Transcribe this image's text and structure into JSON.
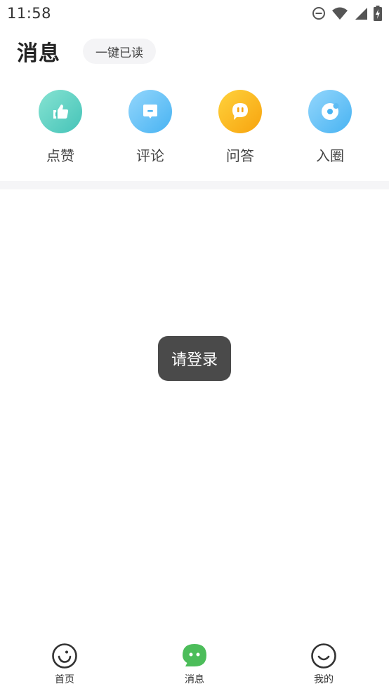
{
  "status_bar": {
    "time": "11:58"
  },
  "header": {
    "title": "消息",
    "mark_all_read": "一键已读"
  },
  "categories": [
    {
      "label": "点赞",
      "icon": "thumbs-up-icon",
      "colors": [
        "#7fe0cf",
        "#49c6bb"
      ]
    },
    {
      "label": "评论",
      "icon": "comment-icon",
      "colors": [
        "#8fd3fb",
        "#4bb6f3"
      ]
    },
    {
      "label": "问答",
      "icon": "qa-icon",
      "colors": [
        "#ffcd35",
        "#f9a80f"
      ]
    },
    {
      "label": "入圈",
      "icon": "circle-icon",
      "colors": [
        "#8fd3fb",
        "#4bb6f3"
      ]
    }
  ],
  "toast": {
    "text": "请登录"
  },
  "bottom_nav": {
    "items": [
      {
        "label": "首页",
        "icon": "home-smile-icon"
      },
      {
        "label": "消息",
        "icon": "message-icon",
        "active": true,
        "accent": "#4cbd5a"
      },
      {
        "label": "我的",
        "icon": "profile-smile-icon"
      }
    ]
  }
}
